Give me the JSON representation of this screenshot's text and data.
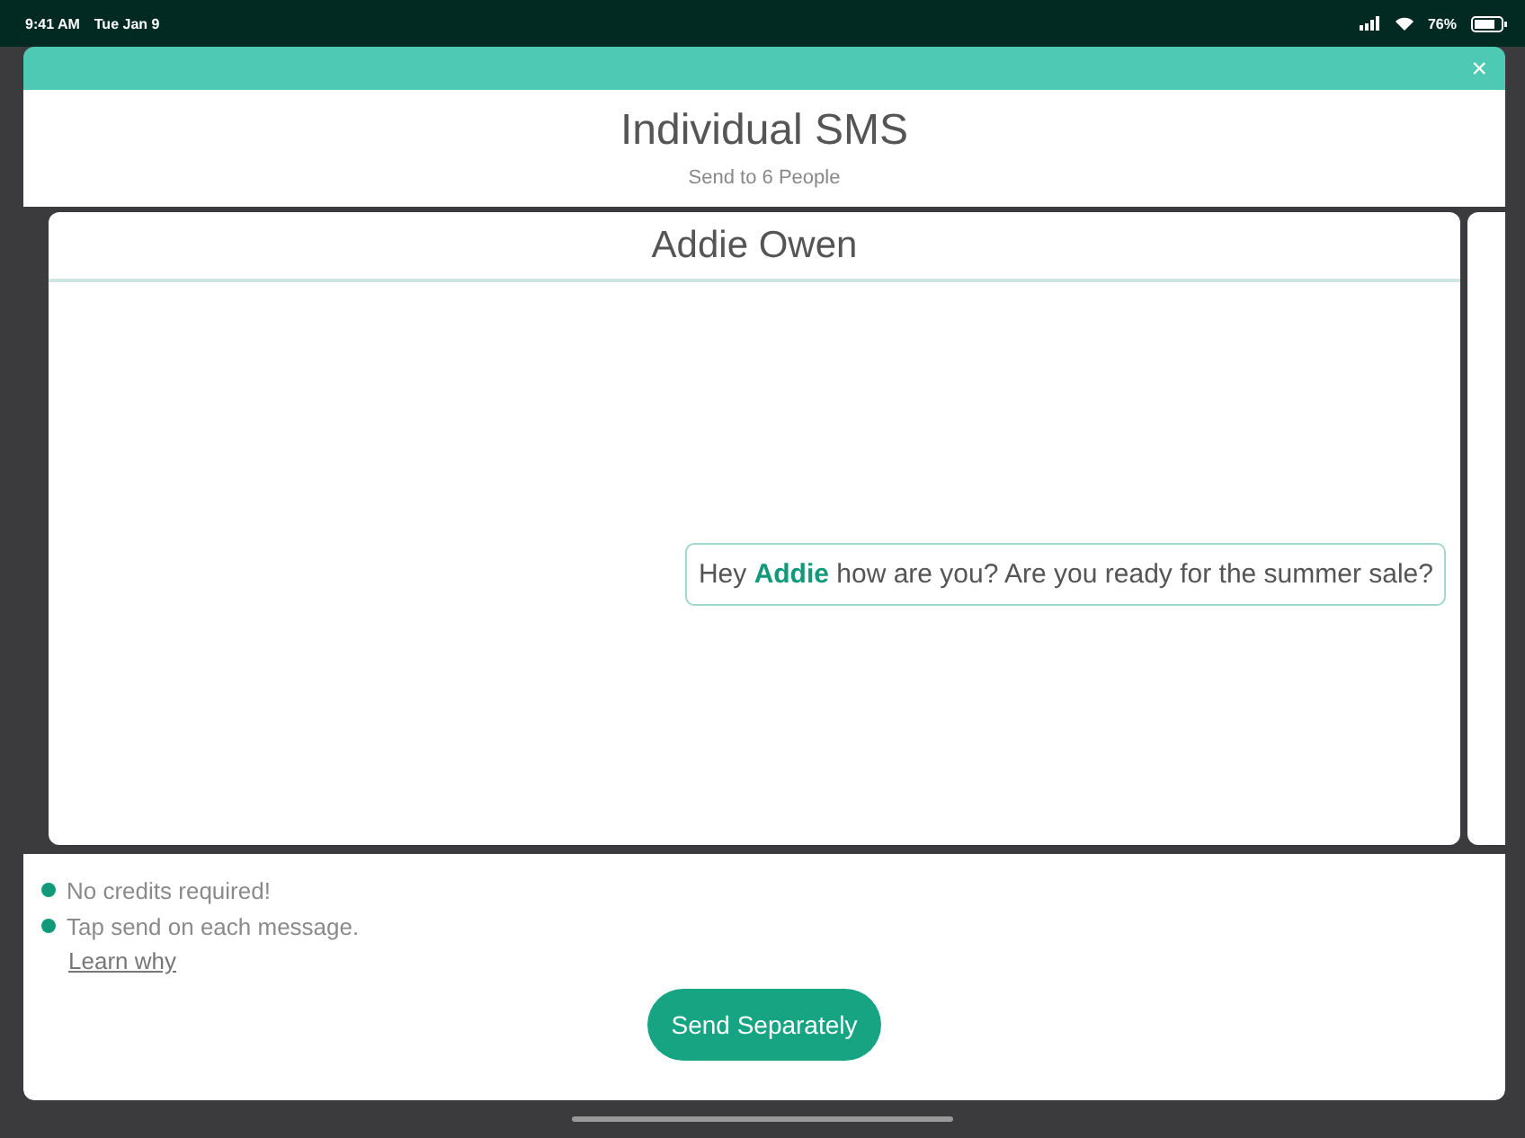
{
  "status_bar": {
    "time": "9:41 AM",
    "date": "Tue Jan 9",
    "battery": "76%"
  },
  "modal": {
    "close": "×",
    "title": "Individual SMS",
    "subtitle": "Send to 6 People"
  },
  "conversation": {
    "recipient": "Addie Owen",
    "message": "Hey **Addie** how are you? Are you ready for the summer sale?"
  },
  "notes": [
    {
      "text": "No credits required!",
      "color": "#109a7a"
    },
    {
      "text": "Tap send on each message.",
      "color": "#109a7a"
    }
  ],
  "link": "Learn why",
  "button": "Send Separately"
}
